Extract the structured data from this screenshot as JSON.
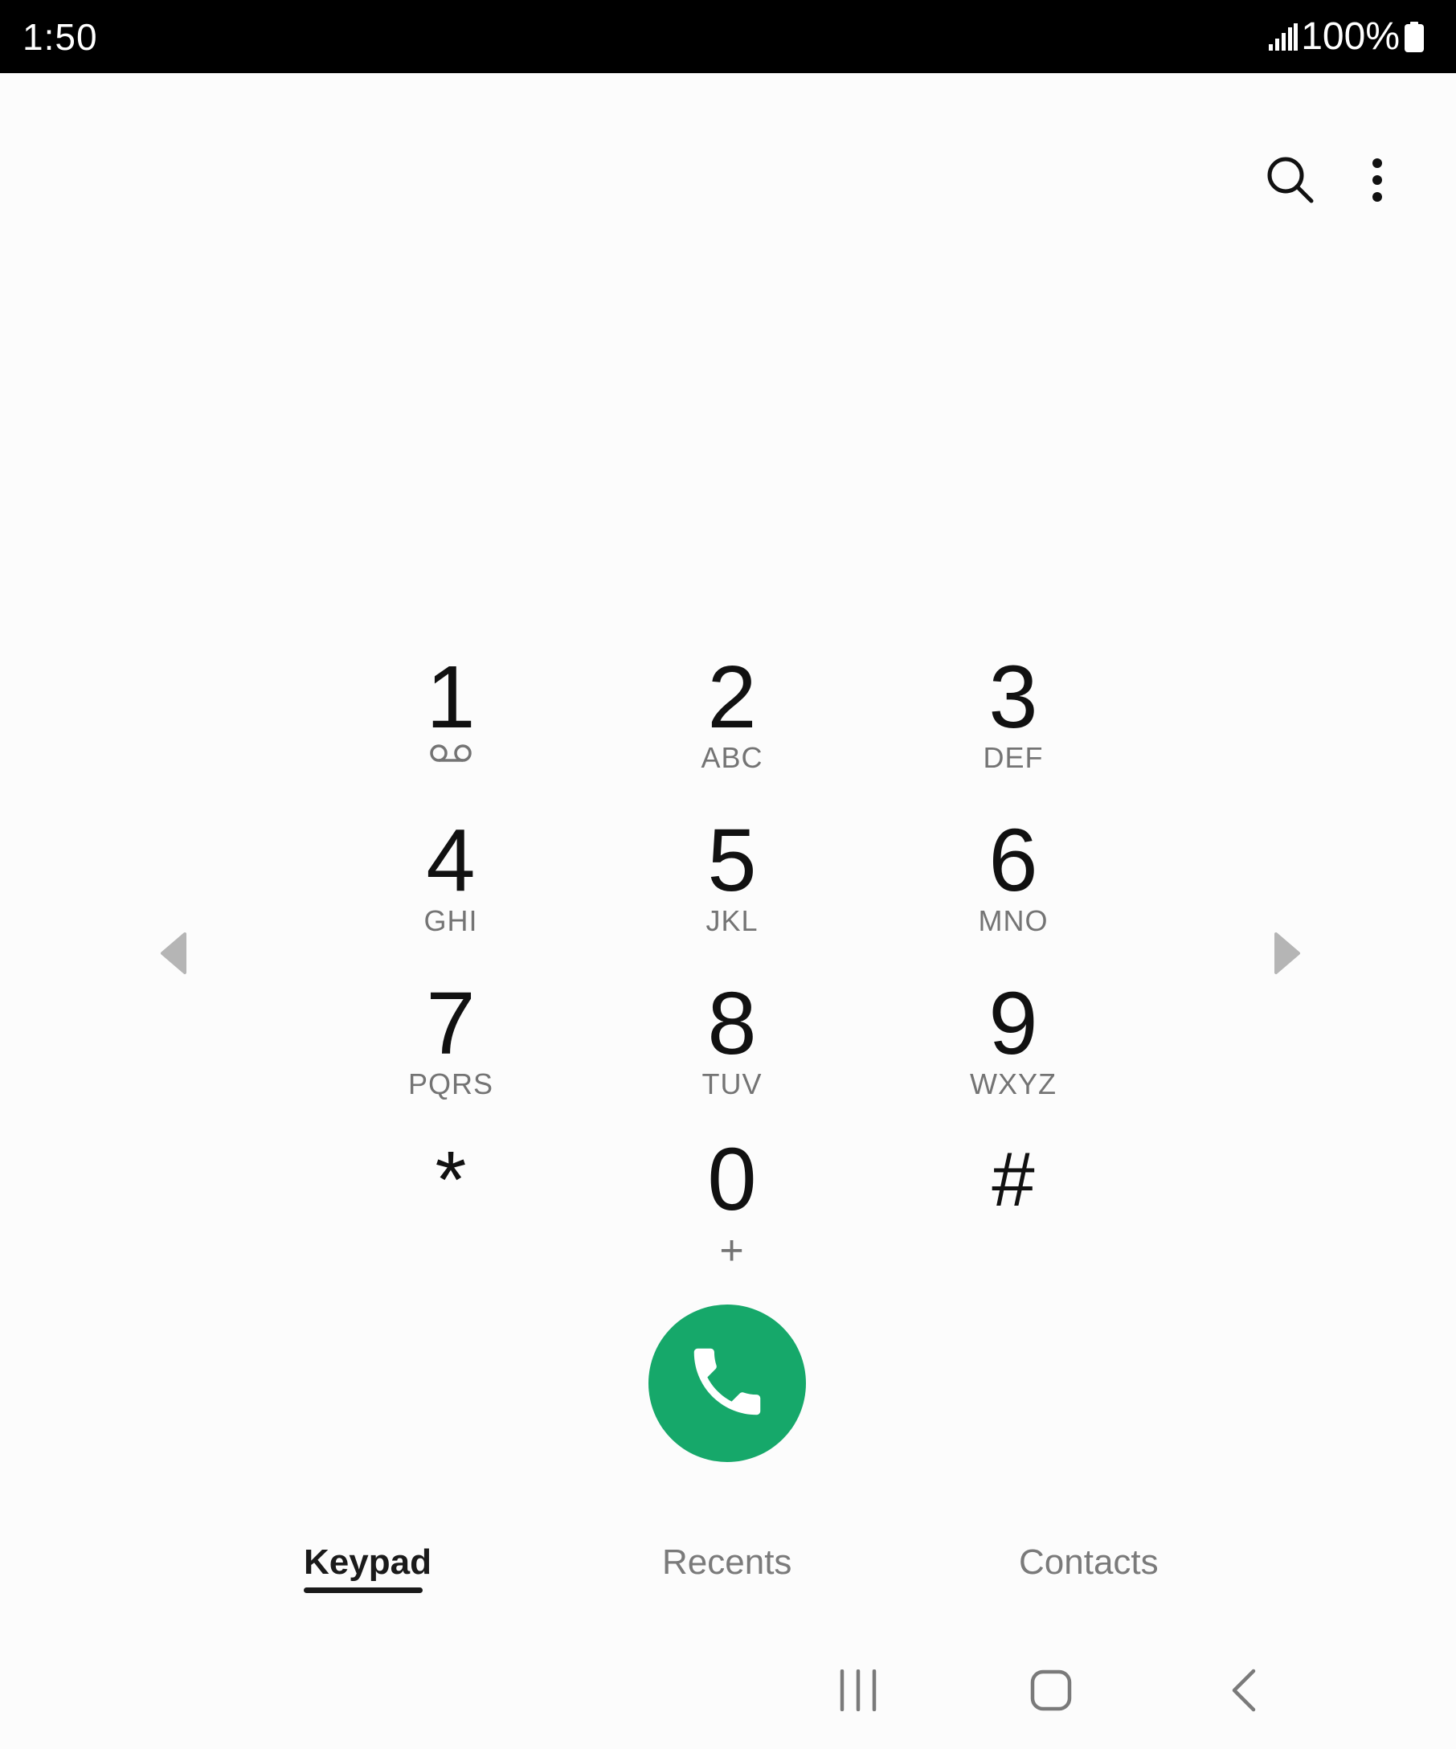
{
  "status_bar": {
    "time": "1:50",
    "battery_percent": "100%",
    "icons": [
      "signal-icon",
      "battery-icon"
    ]
  },
  "top_actions": {
    "icons": [
      "search-icon",
      "more-options-icon"
    ]
  },
  "keypad": {
    "keys": [
      {
        "digit": "1",
        "letters": "",
        "icon": "voicemail-icon"
      },
      {
        "digit": "2",
        "letters": "ABC"
      },
      {
        "digit": "3",
        "letters": "DEF"
      },
      {
        "digit": "4",
        "letters": "GHI"
      },
      {
        "digit": "5",
        "letters": "JKL"
      },
      {
        "digit": "6",
        "letters": "MNO"
      },
      {
        "digit": "7",
        "letters": "PQRS"
      },
      {
        "digit": "8",
        "letters": "TUV"
      },
      {
        "digit": "9",
        "letters": "WXYZ"
      },
      {
        "digit": "*",
        "letters": ""
      },
      {
        "digit": "0",
        "letters": "+"
      },
      {
        "digit": "#",
        "letters": ""
      }
    ]
  },
  "call_button": {
    "icon": "phone-icon",
    "color": "#16a86a"
  },
  "tabs": [
    {
      "label": "Keypad",
      "active": true
    },
    {
      "label": "Recents",
      "active": false
    },
    {
      "label": "Contacts",
      "active": false
    }
  ],
  "nav_bar": {
    "icons": [
      "recent-apps-icon",
      "home-icon",
      "back-icon"
    ]
  }
}
